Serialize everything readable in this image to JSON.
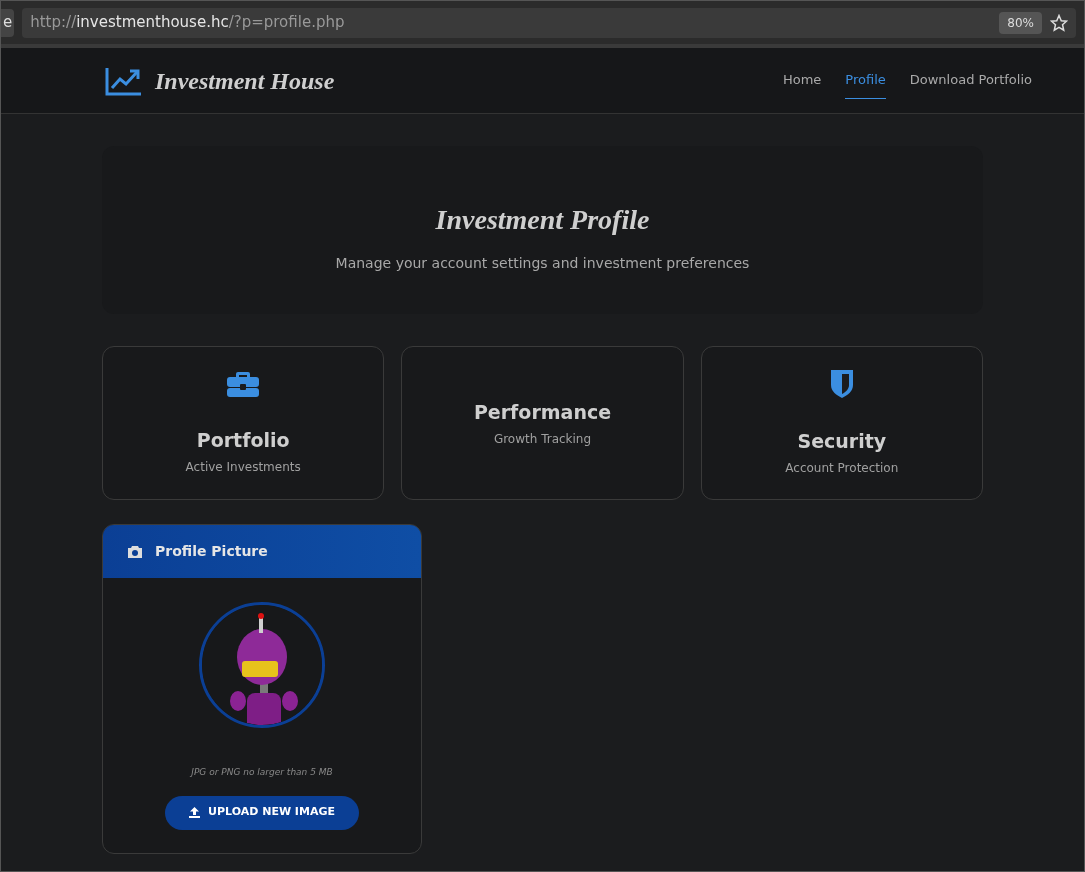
{
  "browser": {
    "tab_fragment": "e",
    "url": {
      "scheme": "http://",
      "host": "investmenthouse.hc",
      "path": "/?p=profile.php"
    },
    "zoom": "80%"
  },
  "navbar": {
    "brand": "Investment House",
    "links": [
      {
        "label": "Home",
        "selected": false
      },
      {
        "label": "Profile",
        "selected": true
      },
      {
        "label": "Download Portfolio",
        "selected": false
      }
    ]
  },
  "hero": {
    "title": "Investment Profile",
    "subtitle": "Manage your account settings and investment preferences"
  },
  "cards": [
    {
      "kind": "briefcase",
      "title": "Portfolio",
      "subtitle": "Active Investments"
    },
    {
      "kind": "plain",
      "title": "Performance",
      "subtitle": "Growth Tracking"
    },
    {
      "kind": "shield",
      "title": "Security",
      "subtitle": "Account Protection"
    }
  ],
  "profile_picture": {
    "title": "Profile Picture",
    "hint": "JPG or PNG no larger than 5 MB",
    "button": "UPLOAD NEW IMAGE"
  }
}
